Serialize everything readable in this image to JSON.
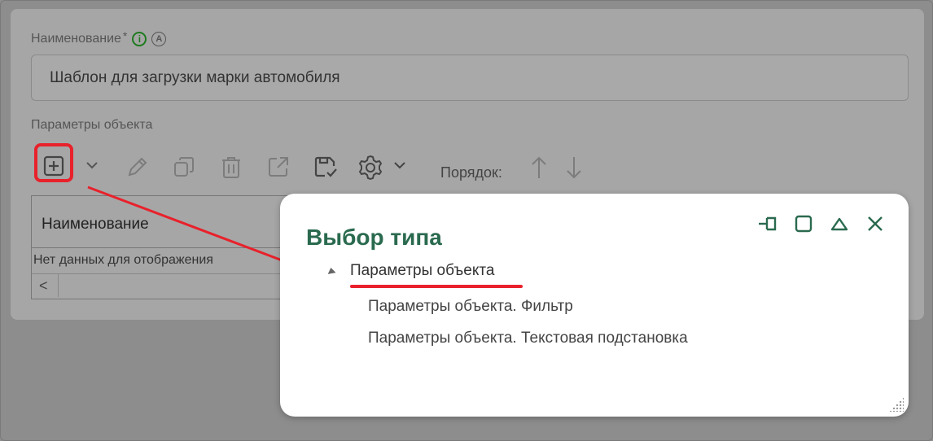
{
  "form": {
    "name_label": "Наименование",
    "required_mark": "*",
    "name_value": "Шаблон для загрузки марки автомобиля",
    "params_label": "Параметры объекта",
    "order_label": "Порядок:"
  },
  "toolbar": {
    "icons": [
      "add-icon",
      "chevron-down-icon",
      "pencil-icon",
      "copy-icon",
      "trash-icon",
      "external-link-icon",
      "save-icon",
      "gear-icon",
      "chevron-down-icon",
      "arrow-up-icon",
      "arrow-down-icon"
    ],
    "highlight_color": "#e8212b"
  },
  "grid": {
    "column_header": "Наименование",
    "empty_text": "Нет данных для отображения",
    "scroll_left": "<"
  },
  "dialog": {
    "title": "Выбор типа",
    "title_color": "#2a6a4f",
    "tree": {
      "root": "Параметры объекта",
      "children": [
        "Параметры объекта. Фильтр",
        "Параметры объекта. Текстовая подстановка"
      ]
    }
  },
  "colors": {
    "accent_green": "#2a6a4f",
    "info_green": "#1e7a1e",
    "annotation_red": "#e8212b"
  }
}
